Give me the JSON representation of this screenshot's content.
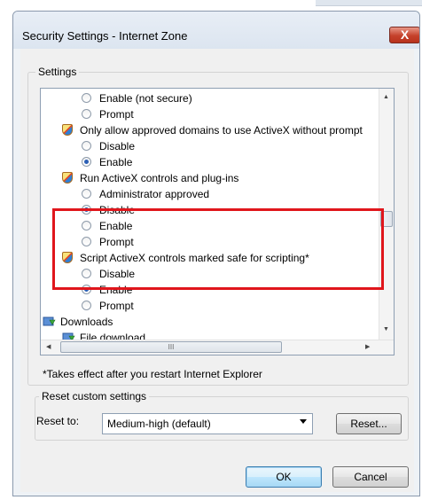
{
  "window": {
    "title": "Security Settings - Internet Zone",
    "close_symbol": "X"
  },
  "settings_group": {
    "label": "Settings"
  },
  "list_items": [
    {
      "kind": "radio",
      "indent": 2,
      "label": "Enable (not secure)",
      "checked": false
    },
    {
      "kind": "radio",
      "indent": 2,
      "label": "Prompt",
      "checked": false
    },
    {
      "kind": "category",
      "indent": 1,
      "icon": "shield-icon",
      "label": "Only allow approved domains to use ActiveX without prompt"
    },
    {
      "kind": "radio",
      "indent": 2,
      "label": "Disable",
      "checked": false
    },
    {
      "kind": "radio",
      "indent": 2,
      "label": "Enable",
      "checked": true
    },
    {
      "kind": "category",
      "indent": 1,
      "icon": "shield-icon",
      "label": "Run ActiveX controls and plug-ins"
    },
    {
      "kind": "radio",
      "indent": 2,
      "label": "Administrator approved",
      "checked": false
    },
    {
      "kind": "radio",
      "indent": 2,
      "label": "Disable",
      "checked": true
    },
    {
      "kind": "radio",
      "indent": 2,
      "label": "Enable",
      "checked": false
    },
    {
      "kind": "radio",
      "indent": 2,
      "label": "Prompt",
      "checked": false
    },
    {
      "kind": "category",
      "indent": 1,
      "icon": "shield-icon",
      "label": "Script ActiveX controls marked safe for scripting*"
    },
    {
      "kind": "radio",
      "indent": 2,
      "label": "Disable",
      "checked": false
    },
    {
      "kind": "radio",
      "indent": 2,
      "label": "Enable",
      "checked": true
    },
    {
      "kind": "radio",
      "indent": 2,
      "label": "Prompt",
      "checked": false
    },
    {
      "kind": "category",
      "indent": 0,
      "icon": "download-icon",
      "label": "Downloads"
    },
    {
      "kind": "category",
      "indent": 1,
      "icon": "download-icon",
      "label": "File download"
    }
  ],
  "scrollbars": {
    "hthumb_glyph": "III"
  },
  "note": "*Takes effect after you restart Internet Explorer",
  "reset_group": {
    "label": "Reset custom settings",
    "reset_to_label": "Reset to:",
    "selected": "Medium-high (default)",
    "reset_button": "Reset..."
  },
  "buttons": {
    "ok": "OK",
    "cancel": "Cancel"
  },
  "colors": {
    "highlight": "#e0161c",
    "radio_dot": "#2b5fb5",
    "close_red": "#c5412b"
  }
}
